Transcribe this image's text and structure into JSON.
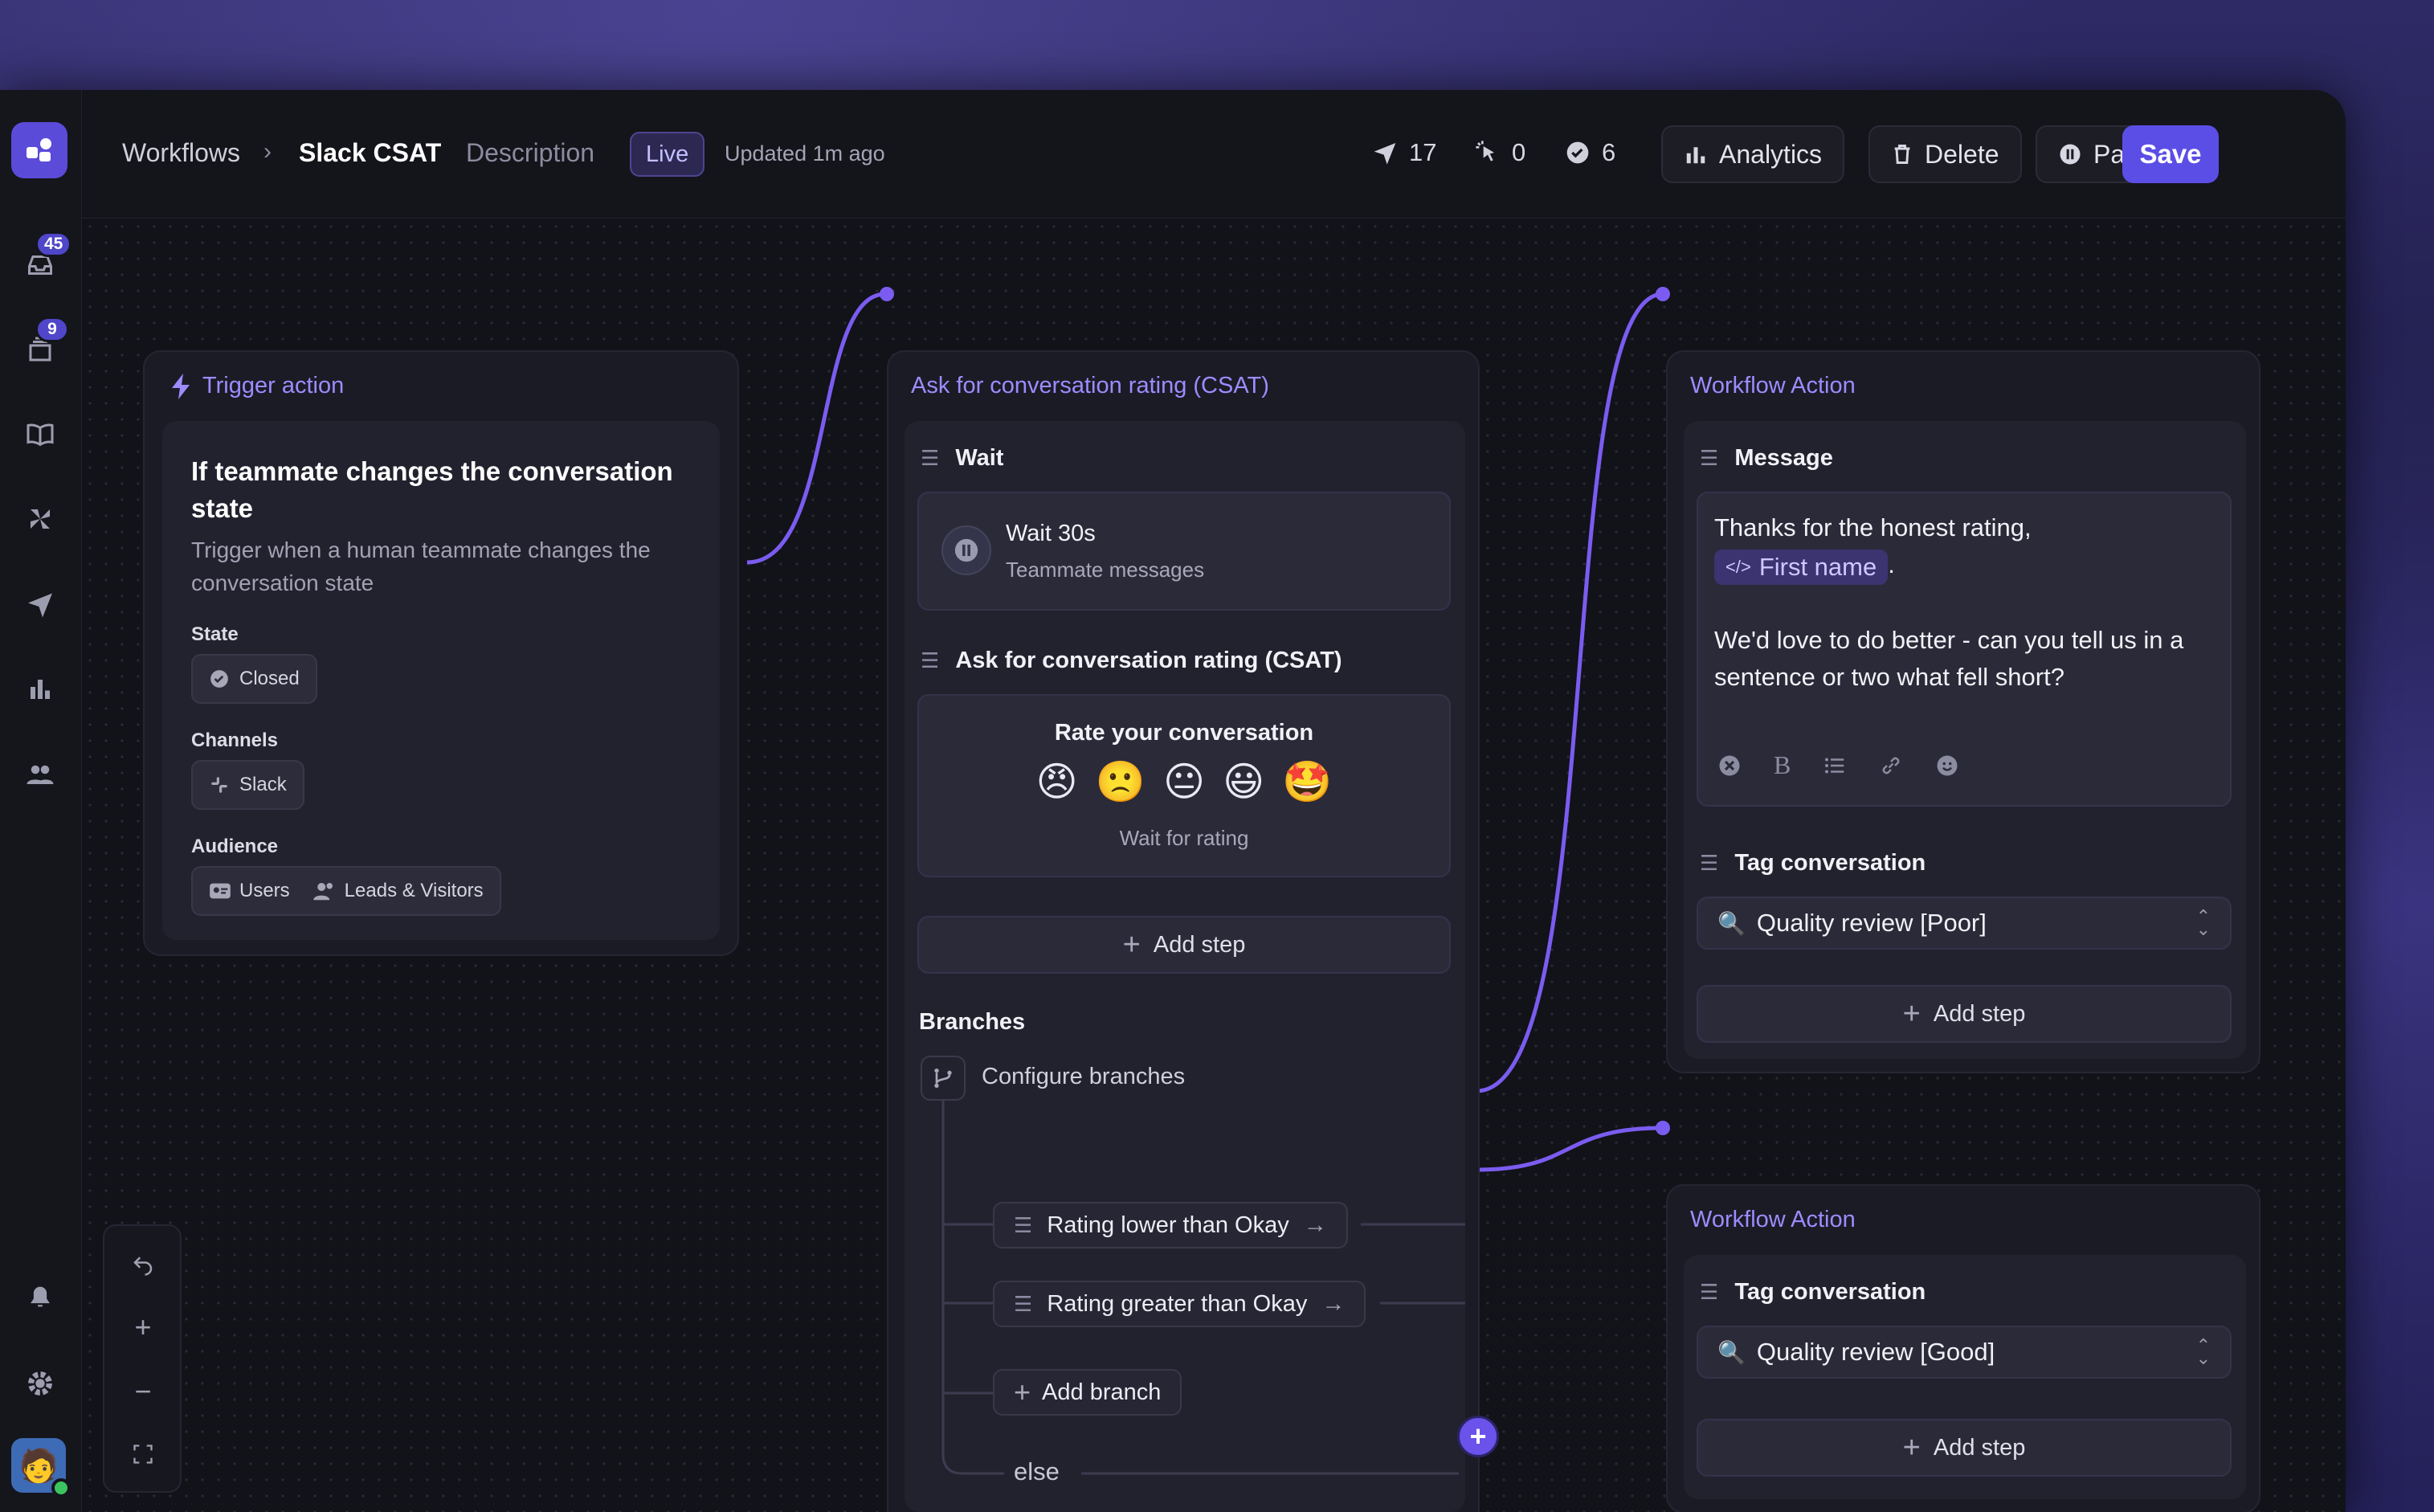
{
  "header": {
    "breadcrumb_root": "Workflows",
    "workflow_name": "Slack CSAT",
    "description_label": "Description",
    "status_badge": "Live",
    "updated": "Updated 1m ago",
    "stats": {
      "sent": "17",
      "clicked": "0",
      "completed": "6"
    },
    "buttons": {
      "analytics": "Analytics",
      "delete": "Delete",
      "pause": "Pause",
      "save": "Save"
    }
  },
  "sidebar": {
    "inbox_badge": "45",
    "tickets_badge": "9"
  },
  "trigger": {
    "node_title": "Trigger action",
    "heading": "If teammate changes the conversation state",
    "description": "Trigger when a human teammate changes the conversation state",
    "state_label": "State",
    "state_value": "Closed",
    "channels_label": "Channels",
    "channel_value": "Slack",
    "audience_label": "Audience",
    "audience_users": "Users",
    "audience_leads": "Leads & Visitors"
  },
  "csat": {
    "node_title": "Ask for conversation rating (CSAT)",
    "wait_title": "Wait",
    "wait_value": "Wait 30s",
    "wait_sub": "Teammate messages",
    "rating_title": "Ask for conversation rating (CSAT)",
    "rate_heading": "Rate your conversation",
    "emojis": [
      "😠",
      "🙁",
      "😐",
      "😃",
      "🤩"
    ],
    "rate_footer": "Wait for rating",
    "add_step": "Add step",
    "branches_label": "Branches",
    "configure_branches": "Configure branches",
    "branch_1": "Rating lower than Okay",
    "branch_2": "Rating greater than Okay",
    "add_branch": "Add branch",
    "else_label": "else"
  },
  "action_poor": {
    "node_title": "Workflow Action",
    "message_title": "Message",
    "message_line1": "Thanks for the honest rating,",
    "message_attr": "First name",
    "message_period": ".",
    "message_line2": "We'd love to do better - can you tell us in a sentence or two what fell short?",
    "tag_title": "Tag conversation",
    "tag_value": "Quality review [Poor]",
    "add_step": "Add step"
  },
  "action_good": {
    "node_title": "Workflow Action",
    "tag_title": "Tag conversation",
    "tag_value": "Quality review [Good]",
    "add_step": "Add step"
  },
  "colors": {
    "accent": "#5b4ee6",
    "node_title": "#9d8cff",
    "wire": "#7b5cf0",
    "online": "#3bc45f"
  }
}
